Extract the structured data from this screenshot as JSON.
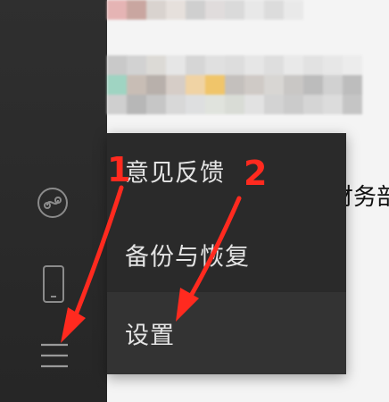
{
  "menu": {
    "items": [
      {
        "label": "意见反馈",
        "icon": "feedback"
      },
      {
        "label": "备份与恢复",
        "icon": "backup"
      },
      {
        "label": "设置",
        "icon": "settings",
        "highlighted": true
      }
    ]
  },
  "sidebar": {
    "icons": [
      "mini-program-icon",
      "phone-icon",
      "menu-icon"
    ]
  },
  "background_text": "财务部",
  "annotations": {
    "step1": "1",
    "step2": "2",
    "arrow_color": "#ff2a1f"
  },
  "colors": {
    "sidebar_bg": "#2c2c2c",
    "popup_bg": "#2a2a2a",
    "popup_highlight": "#333333",
    "menu_text": "#e4e4e4"
  }
}
